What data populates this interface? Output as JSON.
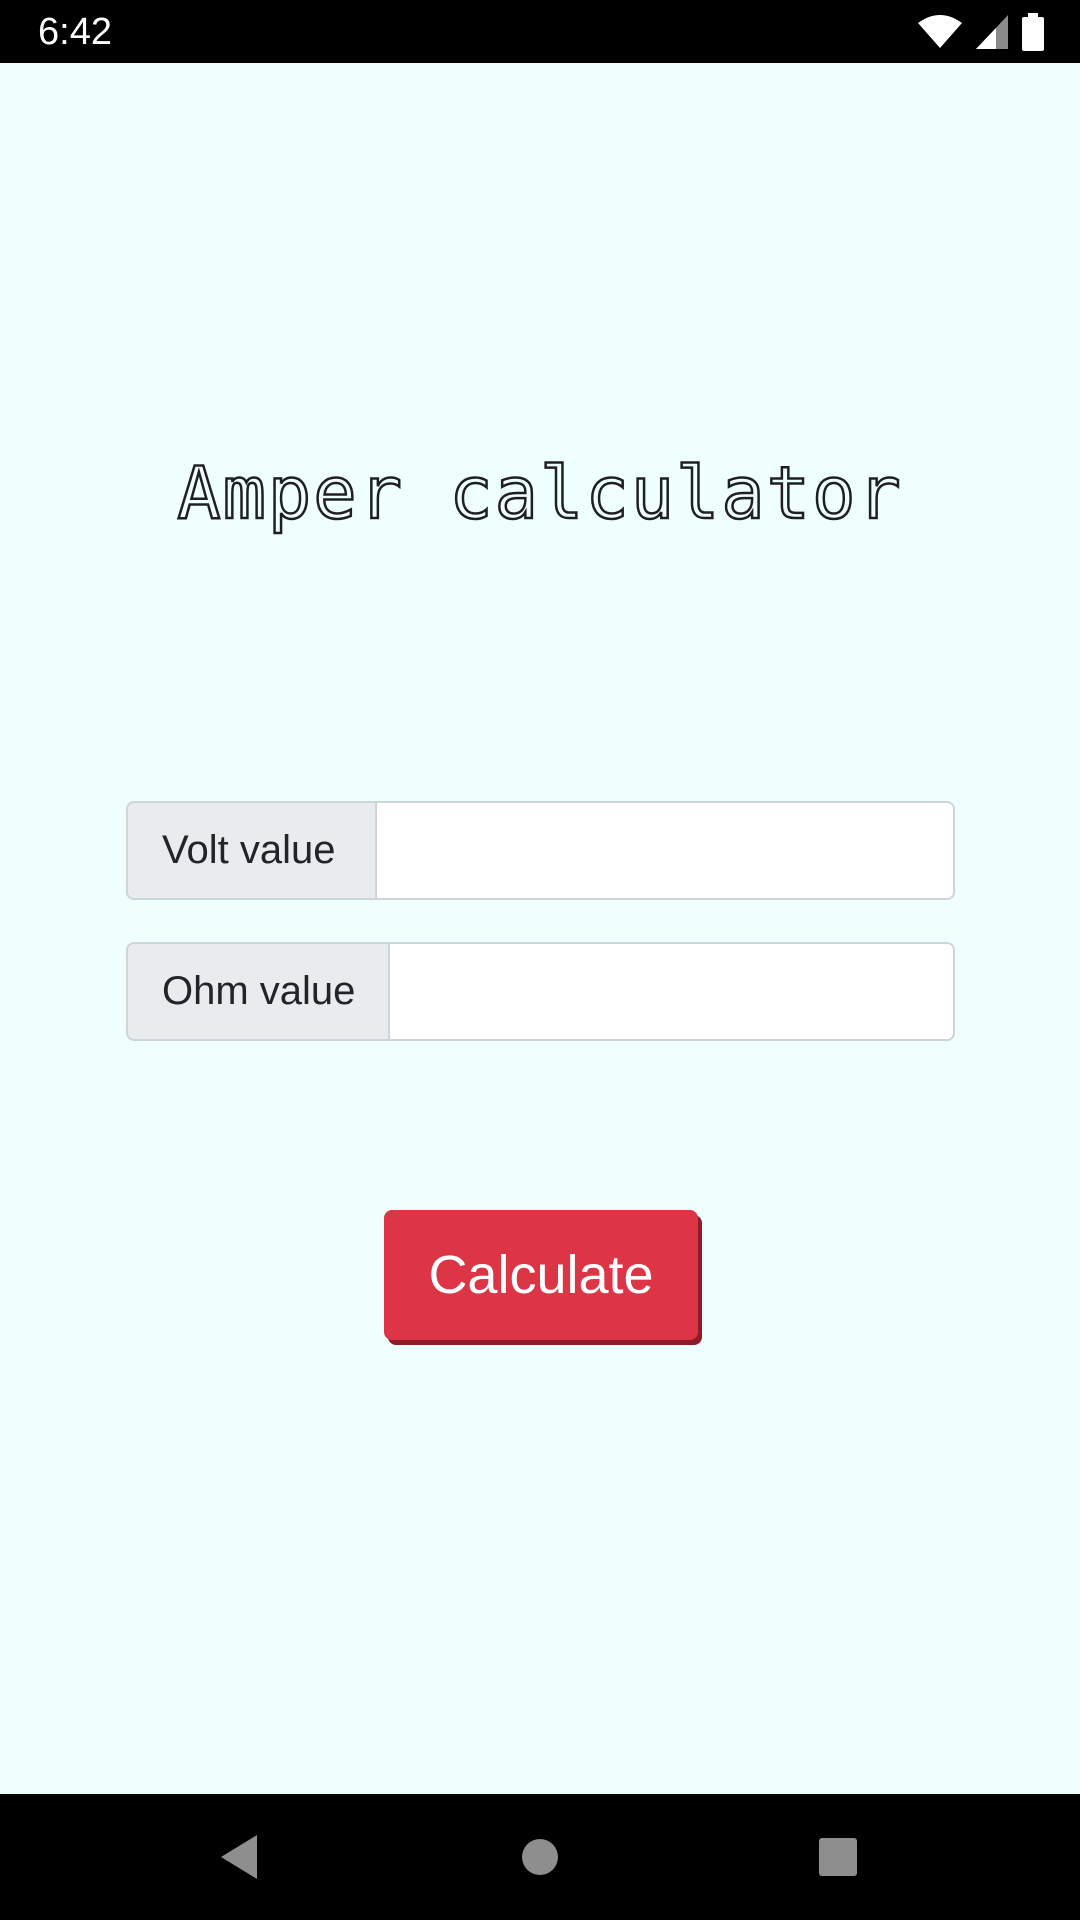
{
  "status_bar": {
    "time": "6:42",
    "icons": [
      "wifi-icon",
      "cell-signal-icon",
      "battery-icon"
    ]
  },
  "app": {
    "title": "Amper calculator",
    "background_color": "#eefffe",
    "fields": [
      {
        "label": "Volt value",
        "value": "",
        "placeholder": ""
      },
      {
        "label": "Ohm value",
        "value": "",
        "placeholder": ""
      }
    ],
    "calculate_label": "Calculate",
    "button_color": "#dc3545"
  },
  "nav_bar": {
    "icons": [
      "back-icon",
      "home-icon",
      "recents-icon"
    ]
  }
}
